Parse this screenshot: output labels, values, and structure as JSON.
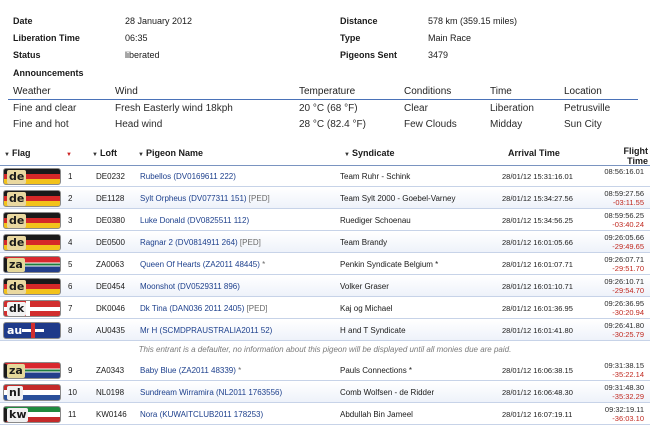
{
  "info": {
    "date_label": "Date",
    "date_value": "28 January 2012",
    "distance_label": "Distance",
    "distance_value": "578 km (359.15 miles)",
    "liberation_time_label": "Liberation Time",
    "liberation_time_value": "06:35",
    "type_label": "Type",
    "type_value": "Main Race",
    "status_label": "Status",
    "status_value": "liberated",
    "pigeons_sent_label": "Pigeons Sent",
    "pigeons_sent_value": "3479",
    "announcements_label": "Announcements"
  },
  "weather": {
    "headers": {
      "weather": "Weather",
      "wind": "Wind",
      "temperature": "Temperature",
      "conditions": "Conditions",
      "time": "Time",
      "location": "Location"
    },
    "rows": [
      {
        "weather": "Fine and clear",
        "wind": "Fresh Easterly wind 18kph",
        "temperature": "20 °C (68 °F)",
        "conditions": "Clear",
        "time": "Liberation",
        "location": "Petrusville"
      },
      {
        "weather": "Fine and hot",
        "wind": "Head wind",
        "temperature": "28 °C (82.4 °F)",
        "conditions": "Few Clouds",
        "time": "Midday",
        "location": "Sun City"
      }
    ]
  },
  "results": {
    "headers": {
      "flag": "Flag",
      "loft": "Loft",
      "pigeon_name": "Pigeon Name",
      "syndicate": "Syndicate",
      "arrival_time": "Arrival Time",
      "flight_time": "Flight Time"
    },
    "rows": [
      {
        "flag": "de",
        "pos": "1",
        "loft": "DE0232",
        "pigeon": "Rubellos",
        "reg": "(DV0169611 222)",
        "ped": "",
        "syndicate": "Team Ruhr - Schink",
        "arrival": "28/01/12 15:31:16.01",
        "flight": "08:56:16.01",
        "diff": ""
      },
      {
        "flag": "de",
        "pos": "2",
        "loft": "DE1128",
        "pigeon": "Sylt Orpheus",
        "reg": "(DV077311 151)",
        "ped": "[PED]",
        "syndicate": "Team Sylt 2000 - Goebel-Varney",
        "arrival": "28/01/12 15:34:27.56",
        "flight": "08:59:27.56",
        "diff": "-03:11.55"
      },
      {
        "flag": "de",
        "pos": "3",
        "loft": "DE0380",
        "pigeon": "Luke Donald",
        "reg": "(DV0825511 112)",
        "ped": "",
        "syndicate": "Ruediger Schoenau",
        "arrival": "28/01/12 15:34:56.25",
        "flight": "08:59:56.25",
        "diff": "-03:40.24"
      },
      {
        "flag": "de",
        "pos": "4",
        "loft": "DE0500",
        "pigeon": "Ragnar 2",
        "reg": "(DV0814911 264)",
        "ped": "[PED]",
        "syndicate": "Team Brandy",
        "arrival": "28/01/12 16:01:05.66",
        "flight": "09:26:05.66",
        "diff": "-29:49.65"
      },
      {
        "flag": "za",
        "pos": "5",
        "loft": "ZA0063",
        "pigeon": "Queen Of Hearts",
        "reg": "(ZA2011 48445)",
        "ped": "*",
        "syndicate": "Penkin Syndicate Belgium *",
        "arrival": "28/01/12 16:01:07.71",
        "flight": "09:26:07.71",
        "diff": "-29:51.70"
      },
      {
        "flag": "de",
        "pos": "6",
        "loft": "DE0454",
        "pigeon": "Moonshot",
        "reg": "(DV0529311 896)",
        "ped": "",
        "syndicate": "Volker Graser",
        "arrival": "28/01/12 16:01:10.71",
        "flight": "09:26:10.71",
        "diff": "-29:54.70"
      },
      {
        "flag": "dk",
        "pos": "7",
        "loft": "DK0046",
        "pigeon": "Dk Tina",
        "reg": "(DAN036 2011 2405)",
        "ped": "[PED]",
        "syndicate": "Kaj og Michael",
        "arrival": "28/01/12 16:01:36.95",
        "flight": "09:26:36.95",
        "diff": "-30:20.94"
      },
      {
        "flag": "au",
        "pos": "8",
        "loft": "AU0435",
        "pigeon": "Mr H",
        "reg": "(SCMDPRAUSTRALIA2011 52)",
        "ped": "",
        "syndicate": "H and T Syndicate",
        "arrival": "28/01/12 16:01:41.80",
        "flight": "09:26:41.80",
        "diff": "-30:25.79"
      }
    ],
    "notice": "This entrant is a defaulter, no information about this pigeon will be displayed until all monies due are paid.",
    "rows2": [
      {
        "flag": "za",
        "pos": "9",
        "loft": "ZA0343",
        "pigeon": "Baby Blue",
        "reg": "(ZA2011 48339)",
        "ped": "*",
        "syndicate": "Pauls Connections *",
        "arrival": "28/01/12 16:06:38.15",
        "flight": "09:31:38.15",
        "diff": "-35:22.14"
      },
      {
        "flag": "nl",
        "pos": "10",
        "loft": "NL0198",
        "pigeon": "Sundream Wirramira",
        "reg": "(NL2011 1763556)",
        "ped": "",
        "syndicate": "Comb Wolfsen - de Ridder",
        "arrival": "28/01/12 16:06:48.30",
        "flight": "09:31:48.30",
        "diff": "-35:32.29"
      },
      {
        "flag": "kw",
        "pos": "11",
        "loft": "KW0146",
        "pigeon": "Nora",
        "reg": "(KUWAITCLUB2011 178253)",
        "ped": "",
        "syndicate": "Abdullah Bin Jameel",
        "arrival": "28/01/12 16:07:19.11",
        "flight": "09:32:19.11",
        "diff": "-36:03.10"
      }
    ]
  }
}
